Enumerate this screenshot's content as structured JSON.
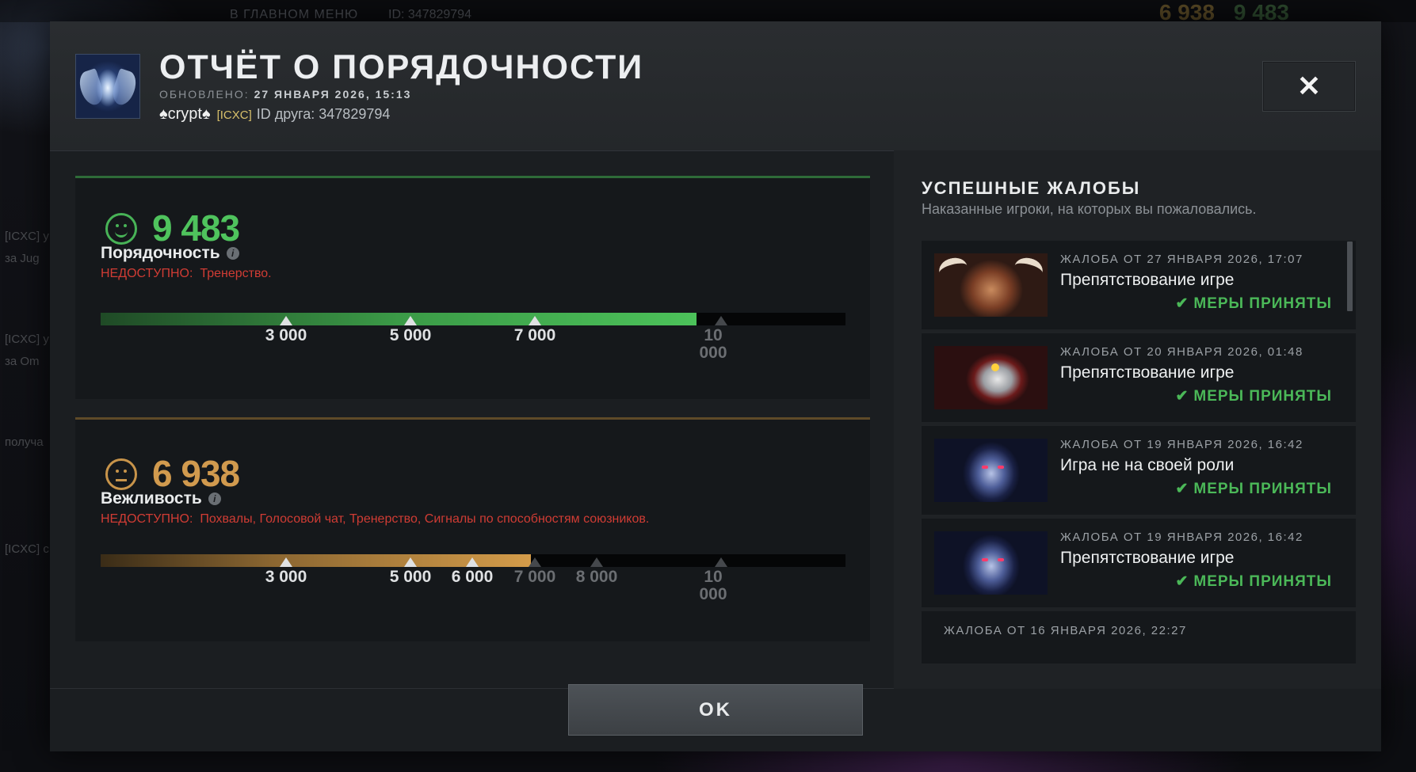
{
  "background": {
    "back_label": "В ГЛАВНОМ МЕНЮ",
    "id_label": "ID: 347829794",
    "courtesy_score": "6 938",
    "behavior_score": "9 483",
    "side_texts": [
      "[ICXC] y",
      "за Jug",
      "[ICXC] y",
      "за Om",
      "получа",
      "[ICXC] c"
    ]
  },
  "header": {
    "title": "ОТЧЁТ О ПОРЯДОЧНОСТИ",
    "updated_label": "ОБНОВЛЕНО:",
    "updated_value": "27 ЯНВАРЯ 2026, 15:13",
    "player_name": "♠crypt♠",
    "player_tag": "[ICXC]",
    "friend_id": "ID друга: 347829794",
    "close_icon": "close-icon"
  },
  "behavior": {
    "score": "9 483",
    "label": "Порядочность",
    "unavailable_label": "НЕДОСТУПНО:",
    "unavailable_items": "Тренерство.",
    "fraction": 0.8,
    "accent": "#4fc35d",
    "ticks": [
      {
        "label": "3 000",
        "value": 3000,
        "reached": true
      },
      {
        "label": "5 000",
        "value": 5000,
        "reached": true
      },
      {
        "label": "7 000",
        "value": 7000,
        "reached": true
      },
      {
        "label": "10 000",
        "value": 10000,
        "reached": false
      }
    ]
  },
  "courtesy": {
    "score": "6 938",
    "label": "Вежливость",
    "unavailable_label": "НЕДОСТУПНО:",
    "unavailable_items": "Похвалы, Голосовой чат, Тренерство, Сигналы по способностям союзников.",
    "fraction": 0.578,
    "accent": "#d19a4e",
    "ticks": [
      {
        "label": "3 000",
        "value": 3000,
        "reached": true
      },
      {
        "label": "5 000",
        "value": 5000,
        "reached": true
      },
      {
        "label": "6 000",
        "value": 6000,
        "reached": true
      },
      {
        "label": "7 000",
        "value": 7000,
        "reached": false
      },
      {
        "label": "8 000",
        "value": 8000,
        "reached": false
      },
      {
        "label": "10 000",
        "value": 10000,
        "reached": false
      }
    ]
  },
  "reports": {
    "title": "УСПЕШНЫЕ ЖАЛОБЫ",
    "subtitle": "Наказанные игроки, на которых вы пожаловались.",
    "status_color": "#4bb858",
    "items": [
      {
        "date": "ЖАЛОБА ОТ 27 ЯНВАРЯ 2026, 17:07",
        "reason": "Препятствование игре",
        "status": "МЕРЫ ПРИНЯТЫ",
        "hero": "beastmaster"
      },
      {
        "date": "ЖАЛОБА ОТ 20 ЯНВАРЯ 2026, 01:48",
        "reason": "Препятствование игре",
        "status": "МЕРЫ ПРИНЯТЫ",
        "hero": "clockwerk"
      },
      {
        "date": "ЖАЛОБА ОТ 19 ЯНВАРЯ 2026, 16:42",
        "reason": "Игра не на своей роли",
        "status": "МЕРЫ ПРИНЯТЫ",
        "hero": "vengeful-spirit"
      },
      {
        "date": "ЖАЛОБА ОТ 19 ЯНВАРЯ 2026, 16:42",
        "reason": "Препятствование игре",
        "status": "МЕРЫ ПРИНЯТЫ",
        "hero": "vengeful-spirit"
      },
      {
        "date": "ЖАЛОБА ОТ 16 ЯНВАРЯ 2026, 22:27"
      }
    ]
  },
  "footer": {
    "ok_label": "OK"
  }
}
